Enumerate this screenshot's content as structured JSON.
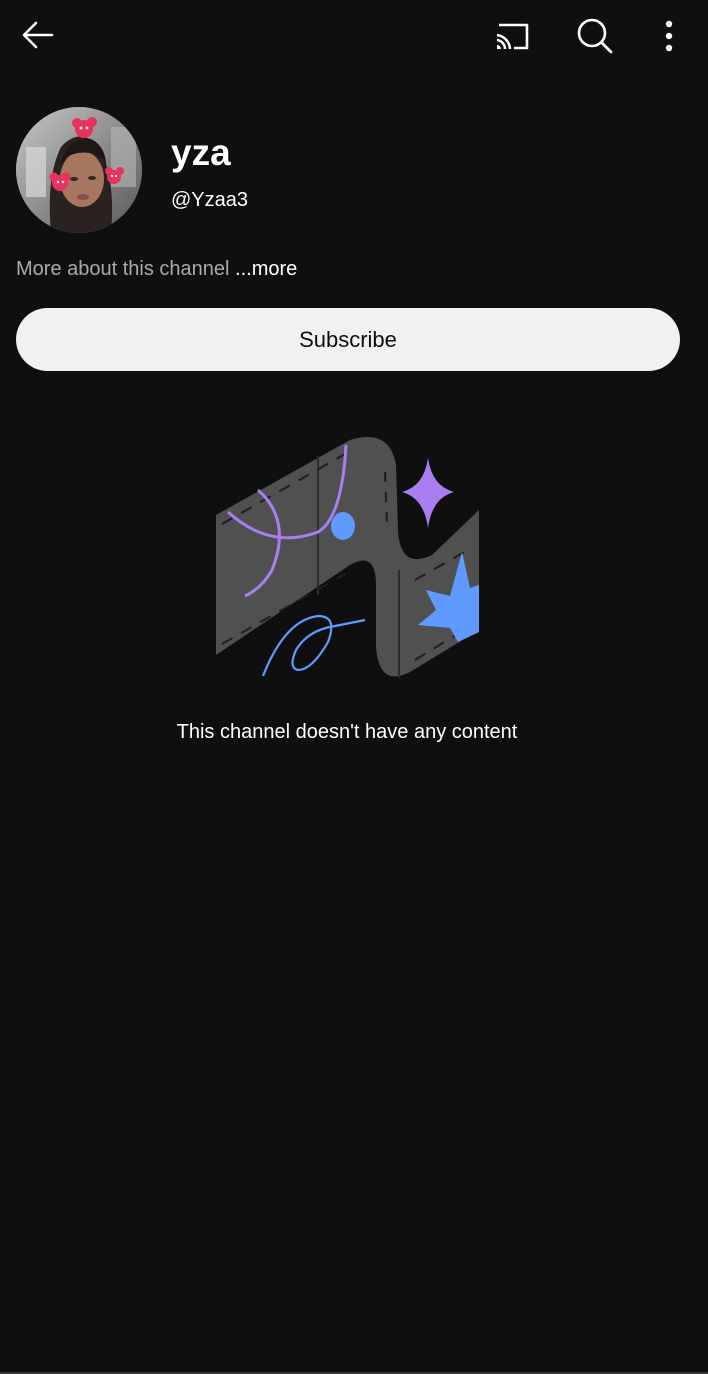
{
  "header": {
    "back_icon": "arrow-left-icon",
    "cast_icon": "cast-icon",
    "search_icon": "search-icon",
    "more_icon": "more-vertical-icon"
  },
  "channel": {
    "name": "yza",
    "handle": "@Yzaa3",
    "about_text": "More about this channel",
    "more_label": "...more",
    "subscribe_label": "Subscribe"
  },
  "empty_state": {
    "message": "This channel doesn't have any content"
  },
  "colors": {
    "background": "#0f0f10",
    "subscribe_bg": "#f1f1f1",
    "muted_text": "#aaaaaa",
    "accent_purple": "#a97ef0",
    "accent_blue": "#5f9bff",
    "illustration_gray": "#505050"
  }
}
